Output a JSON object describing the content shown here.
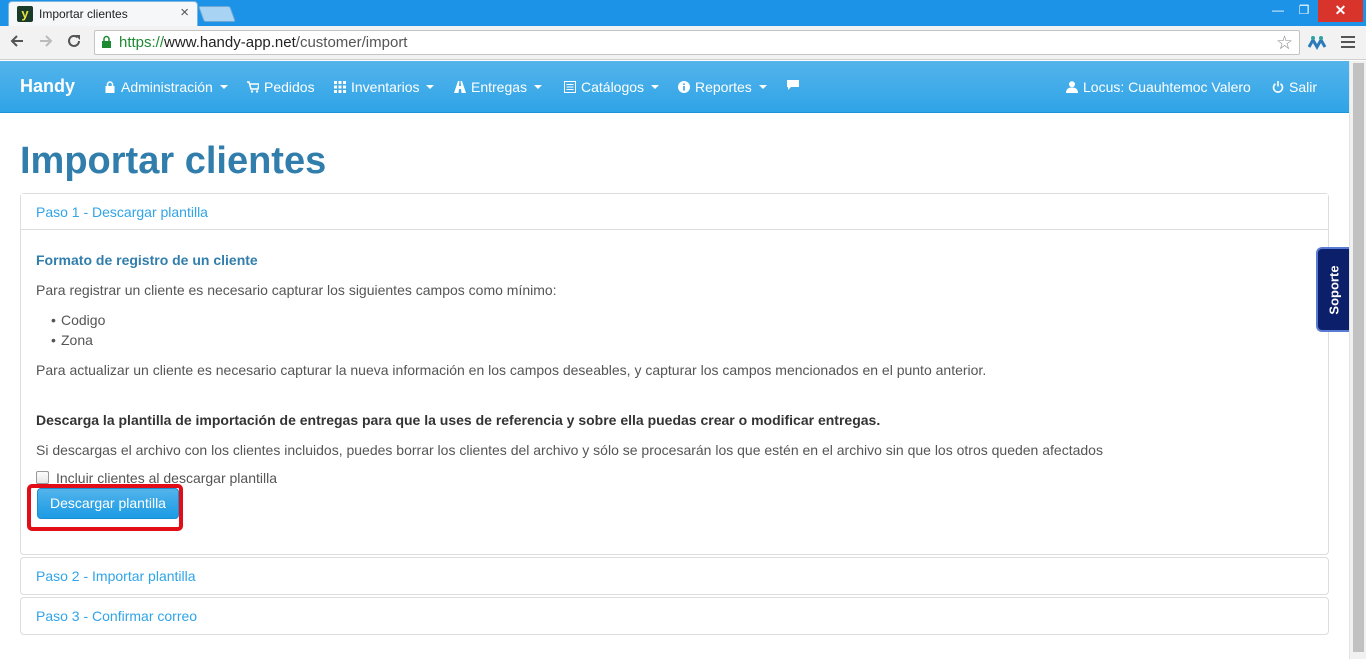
{
  "browser": {
    "tab_title": "Importar clientes",
    "tab_close": "×",
    "url_scheme": "https://",
    "url_host": "www.handy-app.net",
    "url_path": "/customer/import",
    "window_min": "—",
    "window_max": "❐",
    "window_close": "✕",
    "favicon_letter": "y"
  },
  "navbar": {
    "brand": "Handy",
    "items": [
      {
        "label": "Administración",
        "icon": "lock-icon",
        "dropdown": true
      },
      {
        "label": "Pedidos",
        "icon": "cart-icon",
        "dropdown": false
      },
      {
        "label": "Inventarios",
        "icon": "grid-icon",
        "dropdown": true
      },
      {
        "label": "Entregas",
        "icon": "road-icon",
        "dropdown": true
      },
      {
        "label": "Catálogos",
        "icon": "list-icon",
        "dropdown": true
      },
      {
        "label": "Reportes",
        "icon": "info-icon",
        "dropdown": true
      },
      {
        "label": "",
        "icon": "comment-icon",
        "dropdown": false
      }
    ],
    "user": "Locus: Cuauhtemoc Valero",
    "logout": "Salir"
  },
  "page": {
    "title": "Importar clientes"
  },
  "steps": {
    "step1": "Paso 1 - Descargar plantilla",
    "step2": "Paso 2 - Importar plantilla",
    "step3": "Paso 3 - Confirmar correo"
  },
  "step1_body": {
    "heading": "Formato de registro de un cliente",
    "intro": "Para registrar un cliente es necesario capturar los siguientes campos como mínimo:",
    "fields": [
      "Codigo",
      "Zona"
    ],
    "update_note": "Para actualizar un cliente es necesario capturar la nueva información en los campos deseables, y capturar los campos mencionados en el punto anterior.",
    "download_note": "Descarga la plantilla de importación de entregas para que la uses de referencia y sobre ella puedas crear o modificar entregas.",
    "delete_note": "Si descargas el archivo con los clientes incluidos, puedes borrar los clientes del archivo y sólo se procesarán los que estén en el archivo sin que los otros queden afectados",
    "checkbox_label": "Incluir clientes al descargar plantilla",
    "checkbox_checked": false,
    "download_button": "Descargar plantilla"
  },
  "support_tab": "Soporte",
  "colors": {
    "navbar": "#2fa4e7",
    "title": "#317eac",
    "highlight": "#e10e17",
    "support": "#0c1f6a"
  }
}
